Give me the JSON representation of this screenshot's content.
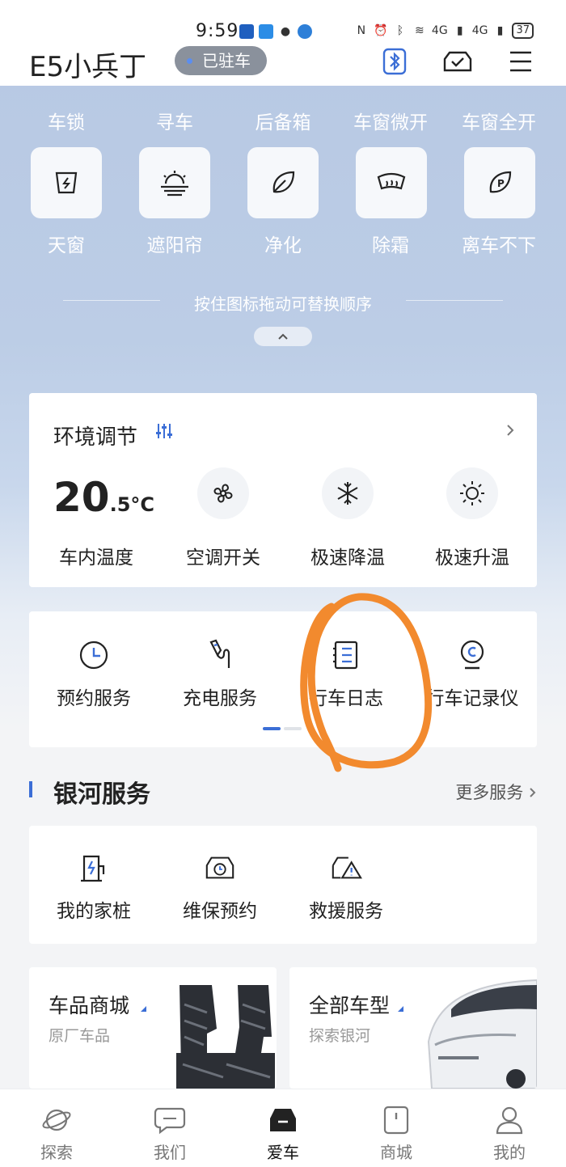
{
  "status_bar": {
    "time": "9:59",
    "network": "4G",
    "network2": "4G",
    "battery": "37"
  },
  "header": {
    "car_name": "E5小兵丁",
    "parked_status": "已驻车"
  },
  "quick_controls": {
    "row1": [
      "车锁",
      "寻车",
      "后备箱",
      "车窗微开",
      "车窗全开"
    ],
    "row2": [
      {
        "label": "天窗",
        "icon": "sunroof-icon"
      },
      {
        "label": "遮阳帘",
        "icon": "sunshade-icon"
      },
      {
        "label": "净化",
        "icon": "leaf-icon"
      },
      {
        "label": "除霜",
        "icon": "defrost-icon"
      },
      {
        "label": "离车不下",
        "icon": "leaf-p-icon"
      }
    ],
    "hint": "按住图标拖动可替换顺序"
  },
  "climate": {
    "title": "环境调节",
    "temp_main": "20",
    "temp_decimal": ".5",
    "temp_unit": "°C",
    "temp_label": "车内温度",
    "controls": [
      "空调开关",
      "极速降温",
      "极速升温"
    ]
  },
  "services": {
    "items": [
      "预约服务",
      "充电服务",
      "行车日志",
      "行车记录仪"
    ]
  },
  "galaxy": {
    "title": "银河服务",
    "more": "更多服务",
    "items": [
      "我的家桩",
      "维保预约",
      "救援服务"
    ]
  },
  "promos": [
    {
      "title": "车品商城",
      "subtitle": "原厂车品"
    },
    {
      "title": "全部车型",
      "subtitle": "探索银河"
    }
  ],
  "bottom_nav": {
    "items": [
      "探索",
      "我们",
      "爱车",
      "商城",
      "我的"
    ],
    "active": "爱车"
  },
  "colors": {
    "accent": "#3b6ed6",
    "annotation": "#f28a2e",
    "badge": "#8a919c"
  }
}
